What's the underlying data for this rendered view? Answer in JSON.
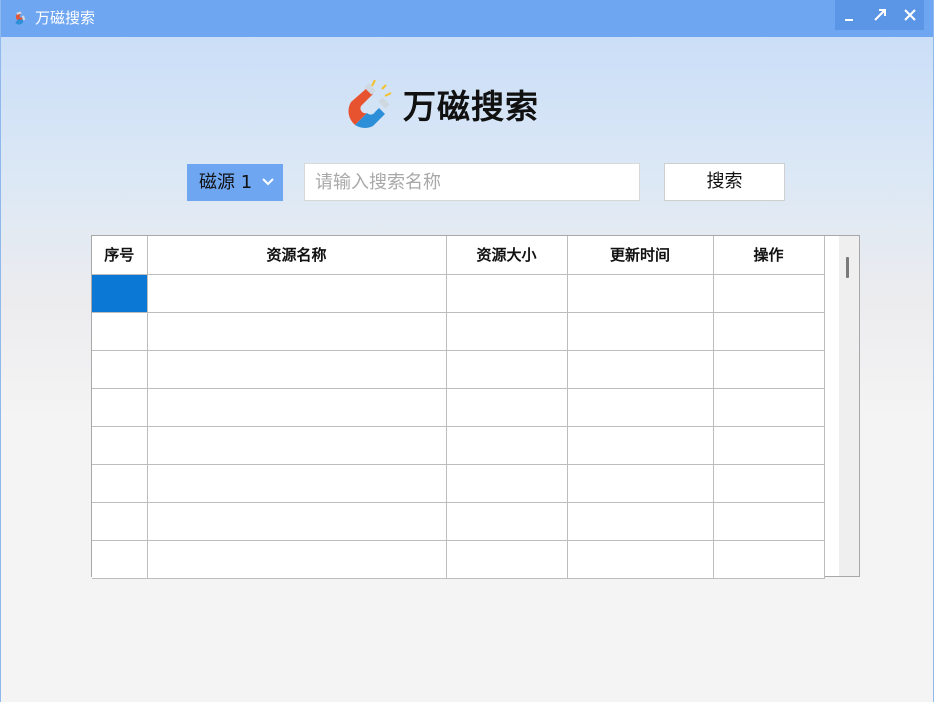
{
  "window": {
    "title": "万磁搜索"
  },
  "header": {
    "app_name": "万磁搜索"
  },
  "search": {
    "source_selected": "磁源 1",
    "placeholder": "请输入搜索名称",
    "value": "",
    "button_label": "搜索"
  },
  "table": {
    "columns": [
      "序号",
      "资源名称",
      "资源大小",
      "更新时间",
      "操作"
    ],
    "rows": [
      [
        "",
        "",
        "",
        "",
        ""
      ],
      [
        "",
        "",
        "",
        "",
        ""
      ],
      [
        "",
        "",
        "",
        "",
        ""
      ],
      [
        "",
        "",
        "",
        "",
        ""
      ],
      [
        "",
        "",
        "",
        "",
        ""
      ],
      [
        "",
        "",
        "",
        "",
        ""
      ],
      [
        "",
        "",
        "",
        "",
        ""
      ],
      [
        "",
        "",
        "",
        "",
        ""
      ]
    ]
  },
  "colors": {
    "titlebar": "#6fa6f2",
    "accent": "#6fa6f2",
    "selection": "#0a78d4",
    "magnet_red": "#e8532f",
    "magnet_blue": "#2d8fd8"
  },
  "icons": {
    "app": "magnet-icon",
    "minimize": "minimize-icon",
    "maximize": "maximize-icon",
    "close": "close-icon",
    "dropdown": "chevron-down-icon"
  }
}
